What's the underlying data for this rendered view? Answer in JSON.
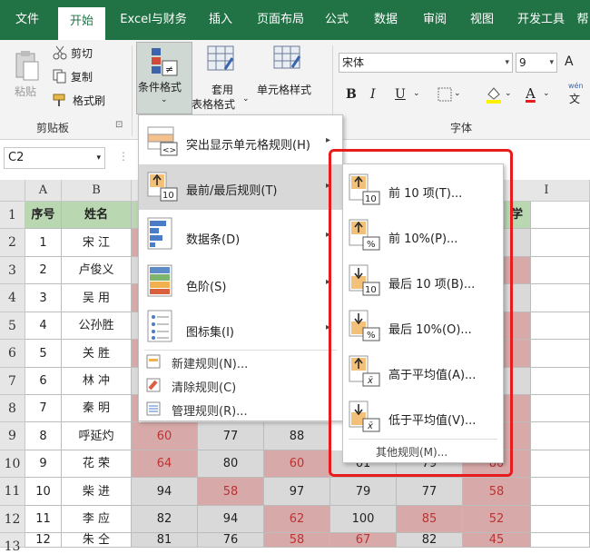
{
  "ribbon_tabs": [
    "文件",
    "开始",
    "Excel与财务",
    "插入",
    "页面布局",
    "公式",
    "数据",
    "审阅",
    "视图",
    "开发工具",
    "帮"
  ],
  "ribbon": {
    "paste": "粘贴",
    "cut": "剪切",
    "copy": "复制",
    "format_painter": "格式刷",
    "clipboard_group": "剪贴板",
    "conditional_format": "条件格式",
    "table_format_line1": "套用",
    "table_format_line2": "表格格式",
    "cell_style": "单元格样式",
    "font_name": "宋体",
    "font_size": "9",
    "font_group": "字体",
    "bold": "B",
    "italic": "I",
    "underline": "U",
    "font_color_glyph": "A",
    "grow_font": "A",
    "phonetic": "wén",
    "phonetic2": "文"
  },
  "name_box": "C2",
  "columns": [
    "A",
    "B",
    "I"
  ],
  "rows": [
    "1",
    "2",
    "3",
    "4",
    "5",
    "6",
    "7",
    "8",
    "9",
    "10",
    "11",
    "12",
    "13"
  ],
  "headers": {
    "a1": "序号",
    "b1": "姓名",
    "h1_partial": "学"
  },
  "names": [
    "宋  江",
    "卢俊义",
    "吴  用",
    "公孙胜",
    "关  胜",
    "林  冲",
    "秦  明",
    "呼延灼",
    "花  荣",
    "柴  进",
    "李  应",
    "朱  仝"
  ],
  "numbers": [
    "1",
    "2",
    "3",
    "4",
    "5",
    "6",
    "7",
    "8",
    "9",
    "10",
    "11",
    "12"
  ],
  "data_rows": [
    [
      "60",
      "77",
      "88"
    ],
    [
      "64",
      "80",
      "60",
      "61",
      "79",
      "80"
    ],
    [
      "94",
      "58",
      "97",
      "79",
      "77",
      "58"
    ],
    [
      "82",
      "94",
      "62",
      "100",
      "85",
      "52"
    ],
    [
      "81",
      "76",
      "58",
      "67",
      "82",
      "45"
    ]
  ],
  "menu_main": {
    "highlight_rules": "突出显示单元格规则(H)",
    "top_bottom_rules": "最前/最后规则(T)",
    "data_bars": "数据条(D)",
    "color_scales": "色阶(S)",
    "icon_sets": "图标集(I)",
    "new_rule": "新建规则(N)...",
    "clear_rules": "清除规则(C)",
    "manage_rules": "管理规则(R)..."
  },
  "menu_sub": {
    "top10": "前 10 项(T)...",
    "top10pct": "前 10%(P)...",
    "bottom10": "最后 10 项(B)...",
    "bottom10pct": "最后 10%(O)...",
    "above_avg": "高于平均值(A)...",
    "below_avg": "低于平均值(V)...",
    "more_rules": "其他规则(M)..."
  },
  "colors": {
    "accent": "#217346",
    "highlight_red": "#e81c1c",
    "cell_red": "#d8a9a9",
    "cell_gray": "#d9d9d9",
    "header_green": "#b9d7b1"
  }
}
